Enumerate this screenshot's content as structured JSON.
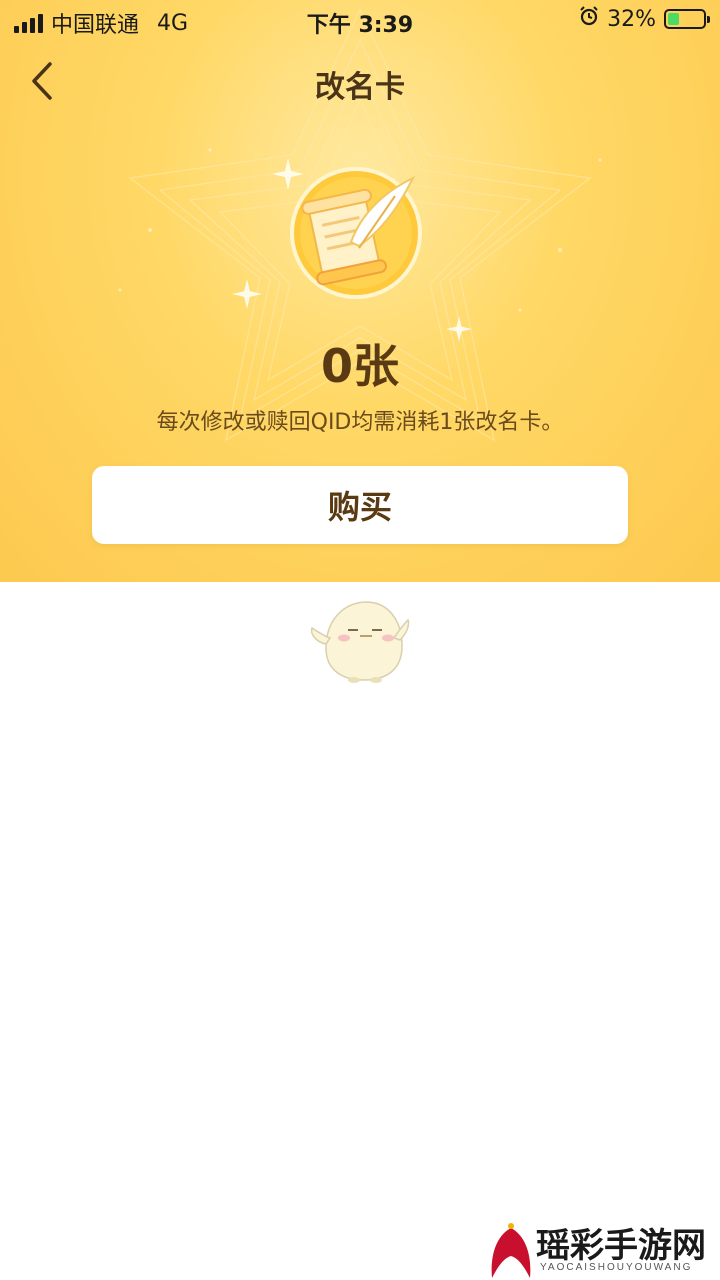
{
  "status_bar": {
    "carrier": "中国联通",
    "network": "4G",
    "time": "下午 3:39",
    "battery_text": "32%",
    "battery_level": 0.32,
    "alarm_icon": "alarm-icon"
  },
  "nav": {
    "title": "改名卡",
    "back_icon": "chevron-left-icon"
  },
  "card": {
    "count_text": "0张",
    "description": "每次修改或赎回QID均需消耗1张改名卡。",
    "icon": "scroll-quill-icon"
  },
  "buy_label": "购买",
  "watermark": {
    "text": "瑶彩手游网",
    "sub": "YAOCAISHOUYOUWANG"
  },
  "colors": {
    "hero": "#fdd35a",
    "accent_text": "#5a3a12",
    "battery": "#4cd964"
  }
}
